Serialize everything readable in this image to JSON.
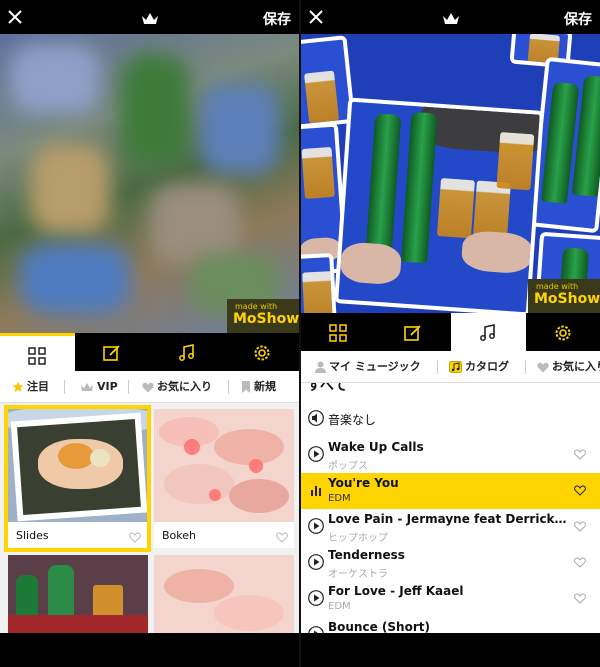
{
  "left": {
    "topbar": {
      "save": "保存"
    },
    "badge": {
      "made": "made with",
      "brand": "MoShow"
    },
    "filters": [
      {
        "label": "注目",
        "icon": "star-icon"
      },
      {
        "label": "VIP",
        "icon": "crown-icon"
      },
      {
        "label": "お気に入り",
        "icon": "heart-icon"
      },
      {
        "label": "新規",
        "icon": "bookmark-icon"
      }
    ],
    "templates": [
      {
        "name": "Slides"
      },
      {
        "name": "Bokeh"
      }
    ]
  },
  "right": {
    "topbar": {
      "save": "保存"
    },
    "badge": {
      "made": "made with",
      "brand": "MoShow"
    },
    "filters": [
      {
        "label": "マイ ミュージック",
        "icon": "person-icon"
      },
      {
        "label": "カタログ",
        "icon": "music-folder-icon"
      },
      {
        "label": "お気に入り",
        "icon": "heart-icon"
      }
    ],
    "list_header": "すべて",
    "no_music": "音楽なし",
    "tracks": [
      {
        "title": "Wake Up Calls",
        "genre": "ポップス"
      },
      {
        "title": "You're You",
        "genre": "EDM"
      },
      {
        "title": "Love Pain - Jermayne feat Derrick Tho...",
        "genre": "ヒップホップ"
      },
      {
        "title": "Tenderness",
        "genre": "オーケストラ"
      },
      {
        "title": "For Love - Jeff Kaael",
        "genre": "EDM"
      },
      {
        "title": "Bounce (Short)",
        "genre": ""
      }
    ]
  },
  "colors": {
    "accent": "#ffd400",
    "bar": "#000000"
  }
}
